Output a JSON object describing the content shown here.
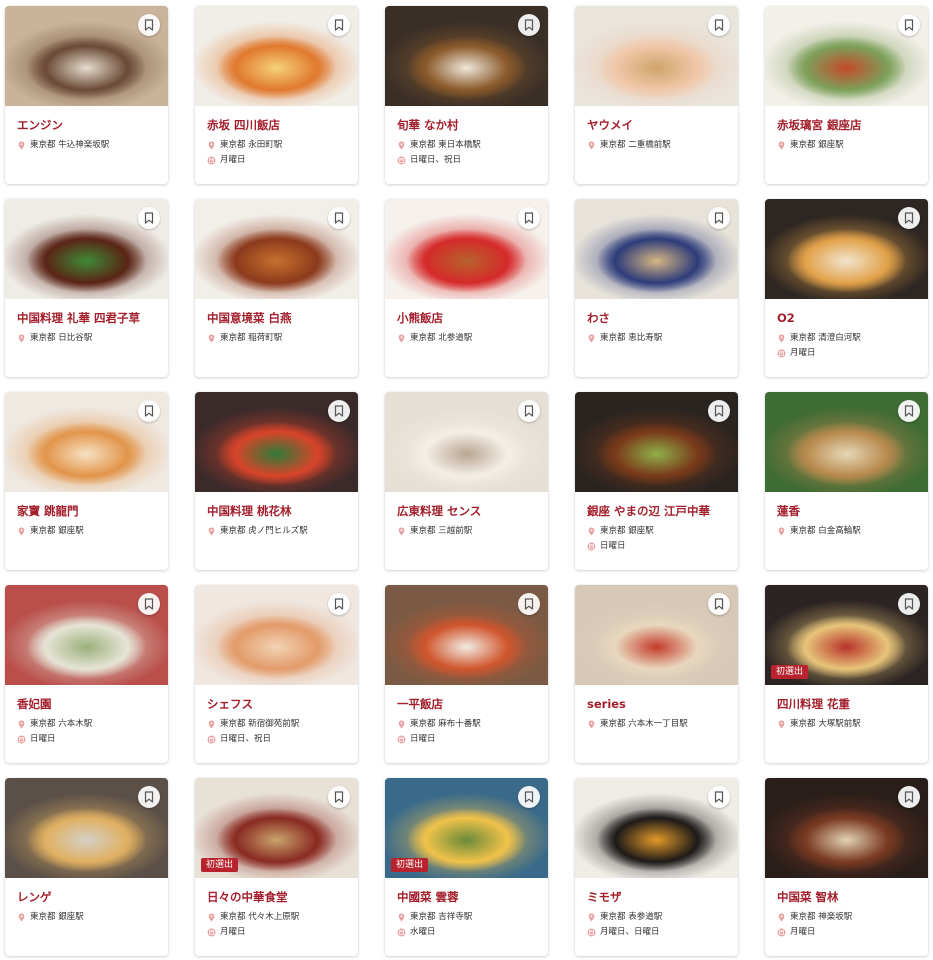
{
  "colors": {
    "accent": "#a31f2c",
    "badge": "#b8232e",
    "icon": "#e8a0a0"
  },
  "badge_label": "初選出",
  "cards": [
    {
      "name": "エンジン",
      "station": "東京都 牛込神楽坂駅",
      "closed": "",
      "badge": false,
      "photo": [
        "#c9b39a",
        "#6b4a36",
        "#e6dccd"
      ]
    },
    {
      "name": "赤坂 四川飯店",
      "station": "東京都 永田町駅",
      "closed": "月曜日",
      "badge": false,
      "photo": [
        "#f1eee8",
        "#e0792e",
        "#f6d27a"
      ]
    },
    {
      "name": "旬華 なか村",
      "station": "東京都 東日本橋駅",
      "closed": "日曜日、祝日",
      "badge": false,
      "photo": [
        "#3a2f27",
        "#8a5a2b",
        "#efe7da"
      ]
    },
    {
      "name": "ヤウメイ",
      "station": "東京都 二重橋前駅",
      "closed": "",
      "badge": false,
      "photo": [
        "#e9e4dc",
        "#f0c7a8",
        "#cfa46c"
      ]
    },
    {
      "name": "赤坂璃宮 銀座店",
      "station": "東京都 銀座駅",
      "closed": "",
      "badge": false,
      "photo": [
        "#f3efe9",
        "#7da05a",
        "#c44a2b"
      ]
    },
    {
      "name": "中国料理 礼華 四君子草",
      "station": "東京都 日比谷駅",
      "closed": "",
      "badge": false,
      "photo": [
        "#efece7",
        "#5a2416",
        "#3f8a36"
      ]
    },
    {
      "name": "中国意境菜 白燕",
      "station": "東京都 稲荷町駅",
      "closed": "",
      "badge": false,
      "photo": [
        "#f2efe9",
        "#8c3a1c",
        "#c7712e"
      ]
    },
    {
      "name": "小熊飯店",
      "station": "東京都 北参道駅",
      "closed": "",
      "badge": false,
      "photo": [
        "#f6f1ec",
        "#d52a2a",
        "#b7632c"
      ]
    },
    {
      "name": "わさ",
      "station": "東京都 恵比寿駅",
      "closed": "",
      "badge": false,
      "photo": [
        "#e8e3da",
        "#2e3c7a",
        "#d7b782"
      ]
    },
    {
      "name": "O2",
      "station": "東京都 清澄白河駅",
      "closed": "月曜日",
      "badge": false,
      "photo": [
        "#2d2622",
        "#e2a24a",
        "#f1e4cf"
      ]
    },
    {
      "name": "家寶 跳龍門",
      "station": "東京都 銀座駅",
      "closed": "",
      "badge": false,
      "photo": [
        "#efe9e2",
        "#e2954a",
        "#f6e1c4"
      ]
    },
    {
      "name": "中国料理 桃花林",
      "station": "東京都 虎ノ門ヒルズ駅",
      "closed": "",
      "badge": false,
      "photo": [
        "#3b2a2a",
        "#d8442a",
        "#2f7a38"
      ]
    },
    {
      "name": "広東料理 センス",
      "station": "東京都 三越前駅",
      "closed": "",
      "badge": false,
      "photo": [
        "#e6dfd6",
        "#f3efe6",
        "#b9a590"
      ]
    },
    {
      "name": "銀座 やまの辺 江戸中華",
      "station": "東京都 銀座駅",
      "closed": "日曜日",
      "badge": false,
      "photo": [
        "#2a2420",
        "#7a3a1a",
        "#8fb04a"
      ]
    },
    {
      "name": "蓮香",
      "station": "東京都 白金高輪駅",
      "closed": "",
      "badge": false,
      "photo": [
        "#3f6b34",
        "#b88a4e",
        "#e6d7b6"
      ]
    },
    {
      "name": "香妃園",
      "station": "東京都 六本木駅",
      "closed": "日曜日",
      "badge": false,
      "photo": [
        "#b94e4a",
        "#e6e4d6",
        "#9bb07a"
      ]
    },
    {
      "name": "シェフス",
      "station": "東京都 新宿御苑前駅",
      "closed": "日曜日、祝日",
      "badge": false,
      "photo": [
        "#efe7e0",
        "#e39b6a",
        "#f2d3b4"
      ]
    },
    {
      "name": "一平飯店",
      "station": "東京都 麻布十番駅",
      "closed": "日曜日",
      "badge": false,
      "photo": [
        "#7a5a44",
        "#d0562e",
        "#f2ece2"
      ]
    },
    {
      "name": "series",
      "station": "東京都 六本木一丁目駅",
      "closed": "",
      "badge": false,
      "photo": [
        "#d7c8b8",
        "#e8d7bd",
        "#c43a2a"
      ]
    },
    {
      "name": "四川料理 花重",
      "station": "東京都 大塚駅前駅",
      "closed": "",
      "badge": true,
      "photo": [
        "#2b2422",
        "#e7c47a",
        "#b8322a"
      ]
    },
    {
      "name": "レンゲ",
      "station": "東京都 銀座駅",
      "closed": "",
      "badge": false,
      "photo": [
        "#5b5048",
        "#e0b062",
        "#d4d0c6"
      ]
    },
    {
      "name": "日々の中華食堂",
      "station": "東京都 代々木上原駅",
      "closed": "月曜日",
      "badge": true,
      "photo": [
        "#e8e1d6",
        "#8a2a22",
        "#c9a36a"
      ]
    },
    {
      "name": "中國菜 雲蓉",
      "station": "東京都 吉祥寺駅",
      "closed": "水曜日",
      "badge": true,
      "photo": [
        "#3a6a8a",
        "#f0c24a",
        "#6a8a3a"
      ]
    },
    {
      "name": "ミモザ",
      "station": "東京都 表参道駅",
      "closed": "月曜日、日曜日",
      "badge": false,
      "photo": [
        "#efece6",
        "#1e1a18",
        "#e39a2a"
      ]
    },
    {
      "name": "中国菜 智林",
      "station": "東京都 神楽坂駅",
      "closed": "月曜日",
      "badge": false,
      "photo": [
        "#2a1e1a",
        "#7a3a22",
        "#e2d2b6"
      ]
    }
  ]
}
